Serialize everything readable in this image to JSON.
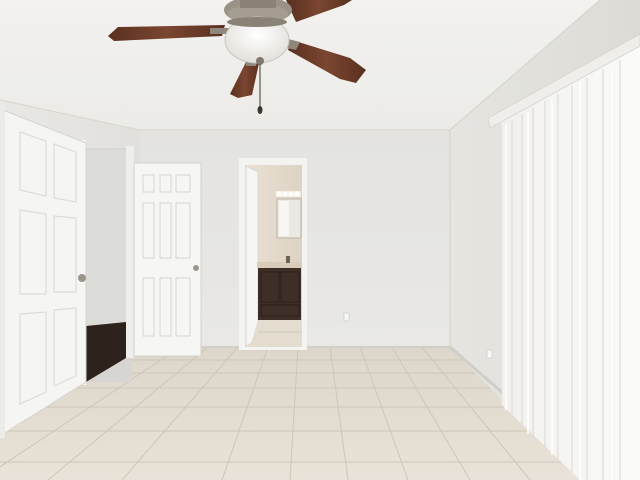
{
  "scene": {
    "description_tag": "empty-bedroom-photo",
    "colors": {
      "ceiling": "#eeedea",
      "wall": "#e7e6e2",
      "wall_shadow": "#dddcd7",
      "floor_tile": "#e1dbd0",
      "grout": "#cfc8bb",
      "door": "#f6f6f4",
      "fan_blade": "#6a3b28",
      "fan_metal": "#8f877c",
      "vanity": "#3d2f27",
      "blinds": "#f5f5f3"
    },
    "icons": [
      "ceiling-fan",
      "light-globe",
      "pull-chain",
      "door-knob",
      "outlet",
      "vanity-light",
      "mirror",
      "sink-faucet"
    ]
  }
}
